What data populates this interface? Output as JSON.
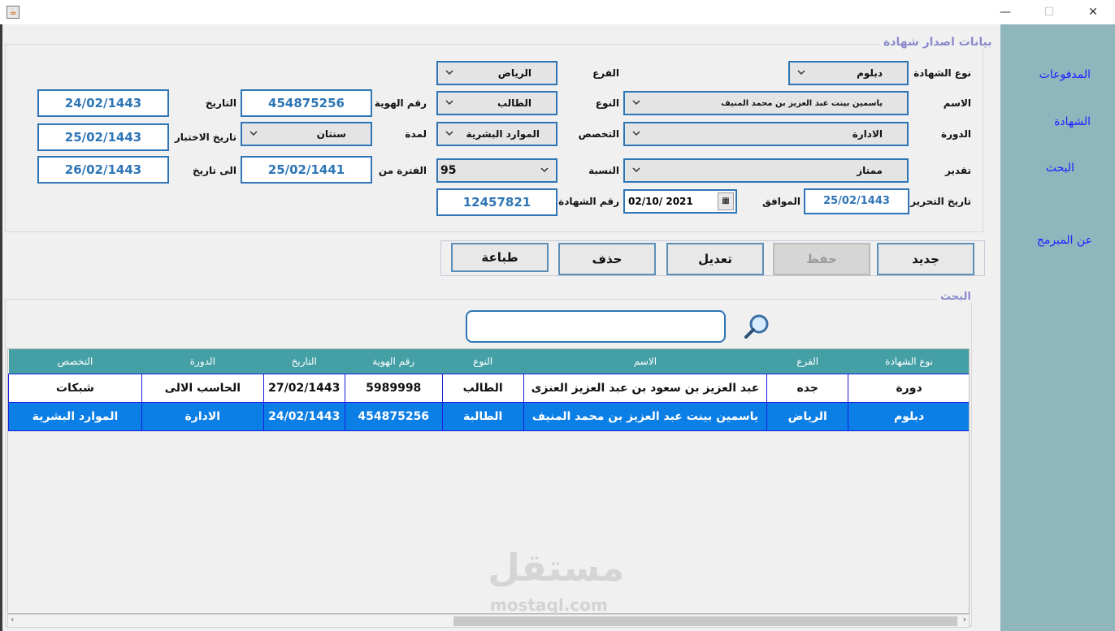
{
  "window": {
    "minimize_glyph": "—",
    "maximize_glyph": "☐",
    "close_glyph": "✕"
  },
  "nav": {
    "payments": "المدفوعات",
    "certificate": "الشهادة",
    "search": "البحث",
    "about": "عن المبرمج"
  },
  "form": {
    "legend": "بيانات اصدار شهادة",
    "cert_type_label": "نوع الشهادة",
    "cert_type_value": "دبلوم",
    "branch_label": "الفرع",
    "branch_value": "الرياض",
    "name_label": "الاسم",
    "name_value": "ياسمين بينت عبد العزيز بن محمد المنيف",
    "gender_label": "النوع",
    "gender_value": "الطالب",
    "id_label": "رقم الهوية",
    "id_value": "454875256",
    "date_label": "التاريخ",
    "date_value": "24/02/1443",
    "course_label": "الدورة",
    "course_value": "الادارة",
    "major_label": "التخصص",
    "major_value": "الموارد البشرية",
    "duration_label": "لمدة",
    "duration_value": "سنتان",
    "exam_date_label": "تاريخ الاختبار",
    "exam_date_value": "25/02/1443",
    "grade_label": "تقدير",
    "grade_value": "ممتاز",
    "percent_label": "النسبة",
    "percent_value": "95",
    "period_from_label": "الفترة من",
    "period_from_value": "25/02/1441",
    "to_date_label": "الى تاريخ",
    "to_date_value": "26/02/1443",
    "issue_date_label": "تاريخ التحرير",
    "issue_date_value": "25/02/1443",
    "corresponding_label": "الموافق",
    "corresponding_value": "02/10/ 2021",
    "cert_no_label": "رقم الشهادة",
    "cert_no_value": "12457821"
  },
  "buttons": {
    "new": "جديد",
    "save": "حفظ",
    "edit": "تعديل",
    "delete": "حذف",
    "print": "طباعة"
  },
  "search": {
    "legend": "البحث",
    "placeholder": ""
  },
  "table": {
    "headers": [
      "نوع الشهادة",
      "الفرع",
      "الاسم",
      "النوع",
      "رقم الهوية",
      "التاريخ",
      "الدورة",
      "التخصص"
    ],
    "rows": [
      [
        "دورة",
        "جده",
        "عبد العزيز بن سعود بن عبد العزيز العنزى",
        "الطالب",
        "5989998",
        "27/02/1443",
        "الحاسب الالى",
        "شبكات"
      ],
      [
        "دبلوم",
        "الرياض",
        "ياسمين بينت عبد العزيز بن محمد المنيف",
        "الطالبة",
        "454875256",
        "24/02/1443",
        "الادارة",
        "الموارد البشرية"
      ]
    ],
    "selected_row": 1
  },
  "watermark": {
    "arabic": "مستقل",
    "latin": "mostaql.com"
  }
}
